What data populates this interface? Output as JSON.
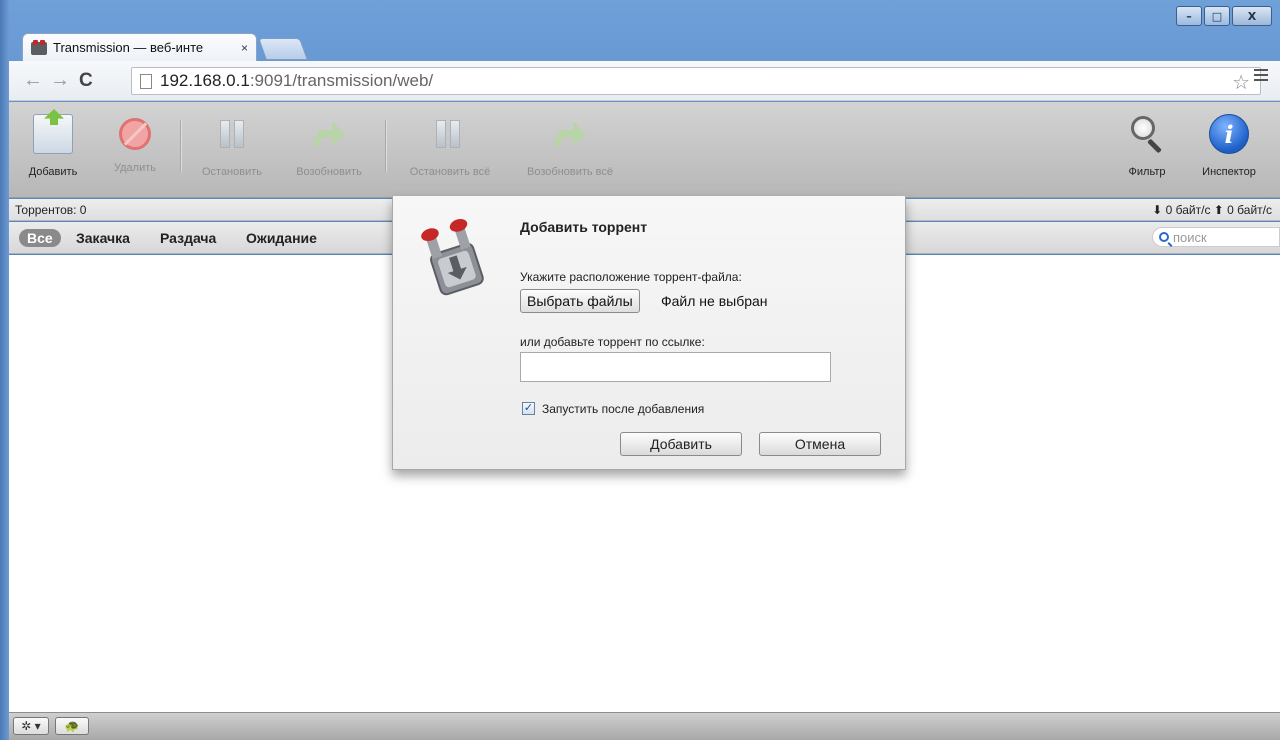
{
  "browser": {
    "tab_title": "Transmission — веб-инте",
    "tab_close": "×",
    "url_host": "192.168.0.1",
    "url_rest": ":9091/transmission/web/",
    "nav_back": "←",
    "nav_forward": "→",
    "nav_reload": "C",
    "star": "☆",
    "window_minimize": "–",
    "window_maximize": "□",
    "window_close": "X"
  },
  "toolbar": {
    "add": "Добавить",
    "remove": "Удалить",
    "pause": "Остановить",
    "resume": "Возобновить",
    "pause_all": "Остановить всё",
    "resume_all": "Возобновить всё",
    "filter": "Фильтр",
    "inspector": "Инспектор"
  },
  "status": {
    "torrent_count": "Торрентов: 0",
    "speeds": "⬇ 0 байт/с ⬆ 0 байт/с"
  },
  "filters": {
    "all": "Все",
    "downloading": "Закачка",
    "seeding": "Раздача",
    "paused": "Ожидание",
    "search_placeholder": "поиск"
  },
  "dialog": {
    "title": "Добавить торрент",
    "file_label": "Укажите расположение торрент-файла:",
    "choose_files": "Выбрать файлы",
    "no_file": "Файл не выбран",
    "url_label": "или добавьте торрент по ссылке:",
    "url_value": "",
    "start_checkbox_label": "Запустить после добавления",
    "start_checked": "✓",
    "add_button": "Добавить",
    "cancel_button": "Отмена"
  },
  "bottom": {
    "settings": "✲ ▾",
    "turtle": "🐢"
  },
  "colors": {
    "accent_blue": "#2c6ac7",
    "title_bar": "#4f7fc0",
    "transmission_red": "#c62828"
  }
}
